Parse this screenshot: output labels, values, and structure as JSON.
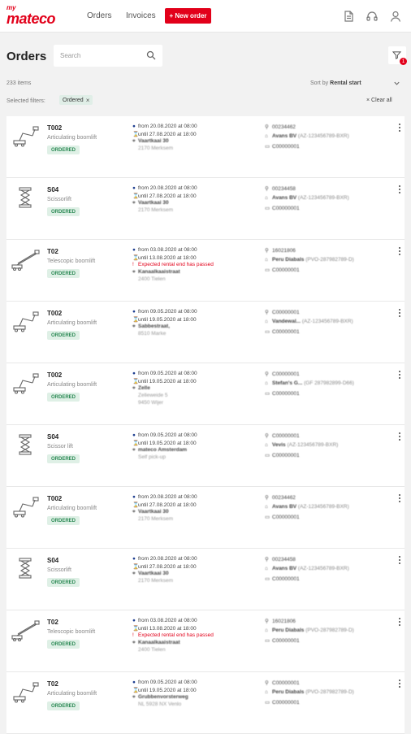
{
  "topbar": {
    "logo_my": "my",
    "logo_brand": "mateco",
    "nav_orders": "Orders",
    "nav_invoices": "Invoices",
    "new_order": "+ New order"
  },
  "page": {
    "title": "Orders",
    "search_placeholder": "Search",
    "filter_count": "1",
    "items_count": "233 items",
    "sort_prefix": "Sort by",
    "sort_value": "Rental start",
    "selected_filters_label": "Selected filters:",
    "chip_label": "Ordered",
    "clear_all": "Clear all"
  },
  "colors": {
    "brand_red": "#e2001a",
    "status_green": "#2c8a55",
    "status_bg": "#dff0e6"
  },
  "orders": [
    {
      "icon": "articulating-boomlift-icon",
      "code": "T002",
      "type": "Articulating boomlift",
      "status": "ORDERED",
      "from": "from 20.08.2020 at 08:00",
      "until": "until 27.08.2020 at 18:00",
      "warning": "",
      "addr1": "Vaartkaai 30",
      "addr2": "2170 Merksem",
      "addr3": "",
      "ref": "00234462",
      "company": "Avans BV",
      "company_id": "(AZ-123456789-BXR)",
      "order_no": "C00000001"
    },
    {
      "icon": "scissorlift-icon",
      "code": "S04",
      "type": "Scissorlift",
      "status": "ORDERED",
      "from": "from 20.08.2020 at 08:00",
      "until": "until 27.08.2020 at 18:00",
      "warning": "",
      "addr1": "Vaartkaai 30",
      "addr2": "2170 Merksem",
      "addr3": "",
      "ref": "00234458",
      "company": "Avans BV",
      "company_id": "(AZ-123456789-BXR)",
      "order_no": "C00000001"
    },
    {
      "icon": "telescopic-boomlift-icon",
      "code": "T02",
      "type": "Telescopic boomlift",
      "status": "ORDERED",
      "from": "from 03.08.2020 at 08:00",
      "until": "until 13.08.2020 at 18:00",
      "warning": "Expected rental end has passed",
      "addr1": "Kanaalkaaistraat",
      "addr2": "2400 Tielen",
      "addr3": "",
      "ref": "16021806",
      "company": "Peru Diabals",
      "company_id": "(PVO-287982789-D)",
      "order_no": "C00000001"
    },
    {
      "icon": "articulating-boomlift-icon",
      "code": "T002",
      "type": "Articulating boomlift",
      "status": "ORDERED",
      "from": "from 09.05.2020 at 08:00",
      "until": "until 19.05.2020 at 18:00",
      "warning": "",
      "addr1": "Sabbestraat,",
      "addr2": "8510 Marke",
      "addr3": "",
      "ref": "C00000001",
      "company": "Vandewal...",
      "company_id": "(AZ-123456789-BXR)",
      "order_no": "C00000001"
    },
    {
      "icon": "articulating-boomlift-icon",
      "code": "T002",
      "type": "Articulating boomlift",
      "status": "ORDERED",
      "from": "from 09.05.2020 at 08:00",
      "until": "until 19.05.2020 at 18:00",
      "warning": "",
      "addr1": "Zelle",
      "addr2": "Zelleweide 5",
      "addr3": "9450 Wijer",
      "ref": "C00000001",
      "company": "Stefan's G...",
      "company_id": "(GF 287982899-D66)",
      "order_no": "C00000001"
    },
    {
      "icon": "scissorlift-icon",
      "code": "S04",
      "type": "Scissor lift",
      "status": "ORDERED",
      "from": "from 09.05.2020 at 08:00",
      "until": "until 19.05.2020 at 18:00",
      "warning": "",
      "addr1": "mateco Amsterdam",
      "addr2": "Self pick-up",
      "addr3": "",
      "ref": "C00000001",
      "company": "Vevis",
      "company_id": "(AZ-123456789-BXR)",
      "order_no": "C00000001"
    },
    {
      "icon": "articulating-boomlift-icon",
      "code": "T002",
      "type": "Articulating boomlift",
      "status": "ORDERED",
      "from": "from 20.08.2020 at 08:00",
      "until": "until 27.08.2020 at 18:00",
      "warning": "",
      "addr1": "Vaartkaai 30",
      "addr2": "2170 Merksem",
      "addr3": "",
      "ref": "00234462",
      "company": "Avans BV",
      "company_id": "(AZ-123456789-BXR)",
      "order_no": "C00000001"
    },
    {
      "icon": "scissorlift-icon",
      "code": "S04",
      "type": "Scissorlift",
      "status": "ORDERED",
      "from": "from 20.08.2020 at 08:00",
      "until": "until 27.08.2020 at 18:00",
      "warning": "",
      "addr1": "Vaartkaai 30",
      "addr2": "2170 Merksem",
      "addr3": "",
      "ref": "00234458",
      "company": "Avans BV",
      "company_id": "(AZ-123456789-BXR)",
      "order_no": "C00000001"
    },
    {
      "icon": "telescopic-boomlift-icon",
      "code": "T02",
      "type": "Telescopic boomlift",
      "status": "ORDERED",
      "from": "from 03.08.2020 at 08:00",
      "until": "until 13.08.2020 at 18:00",
      "warning": "Expected rental end has passed",
      "addr1": "Kanaalkaaistraat",
      "addr2": "2400 Tielen",
      "addr3": "",
      "ref": "16021806",
      "company": "Peru Diabals",
      "company_id": "(PVO-287982789-D)",
      "order_no": "C00000001"
    },
    {
      "icon": "articulating-boomlift-icon",
      "code": "T02",
      "type": "Articulating boomlift",
      "status": "ORDERED",
      "from": "from 09.05.2020 at 08:00",
      "until": "until 19.05.2020 at 18:00",
      "warning": "",
      "addr1": "Grubbenvorsterweg",
      "addr2": "NL 5928 NX Venlo",
      "addr3": "",
      "ref": "C00000001",
      "company": "Peru Diabals",
      "company_id": "(PVO-287982789-D)",
      "order_no": "C00000001"
    }
  ]
}
